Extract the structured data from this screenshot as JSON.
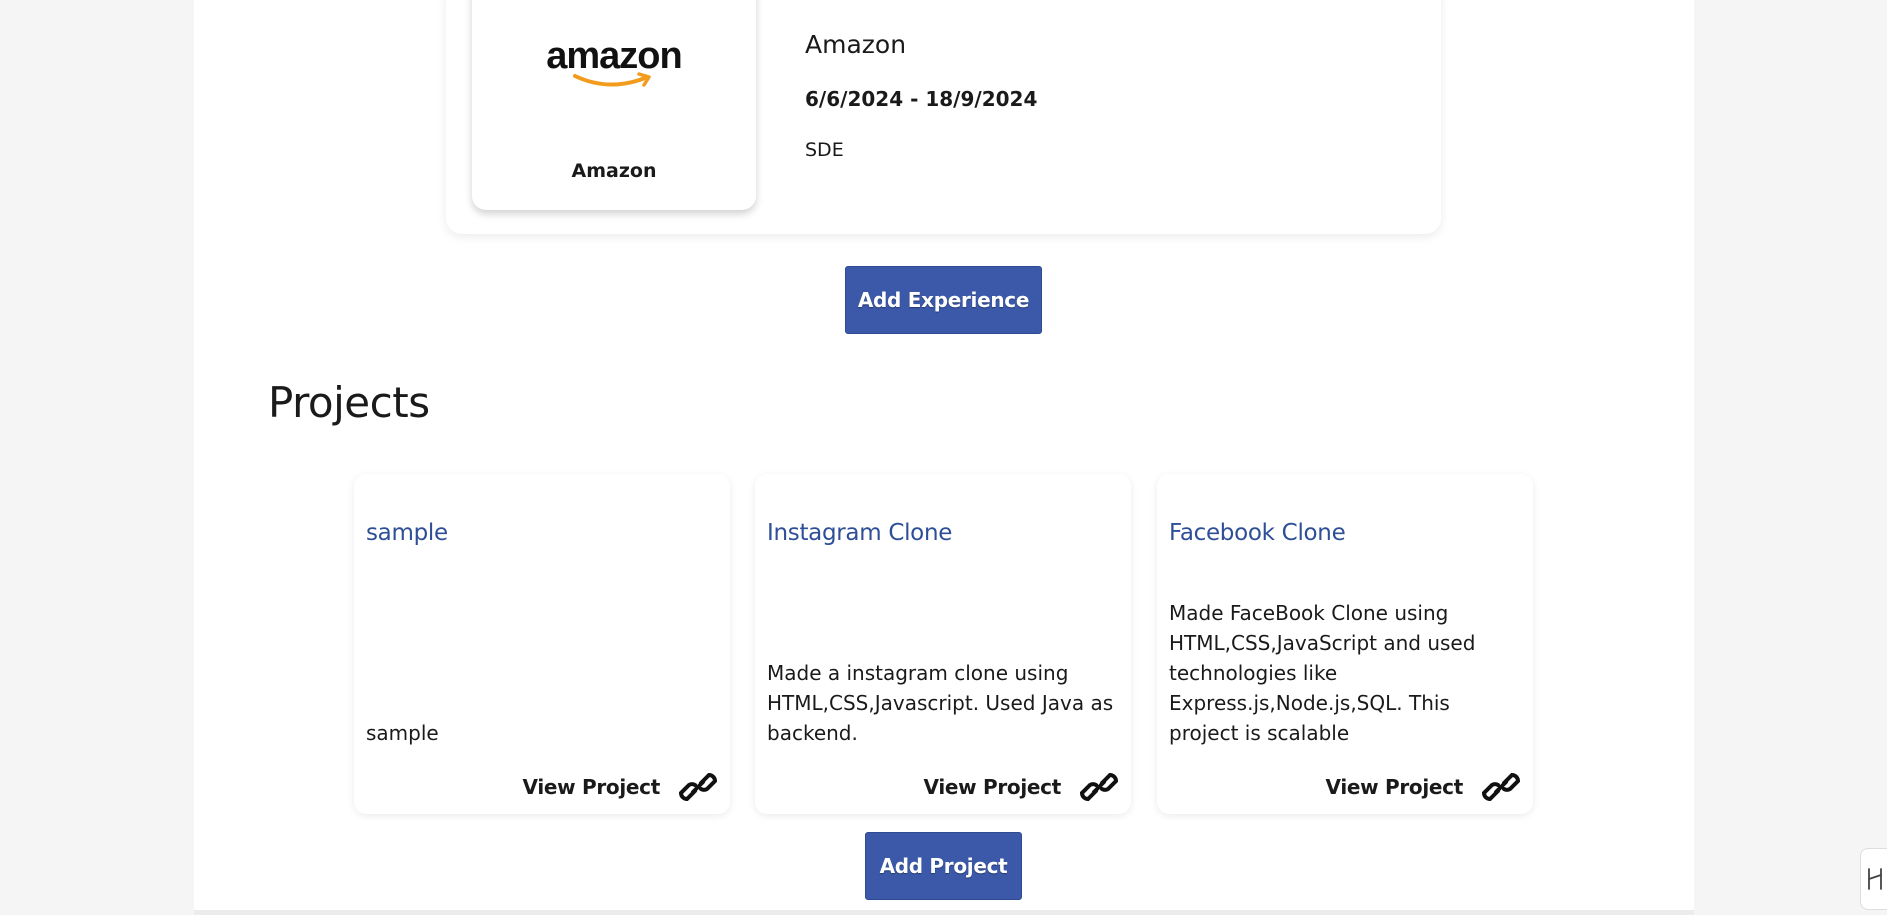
{
  "experience": {
    "logo_text": "amazon",
    "logo_caption": "Amazon",
    "company": "Amazon",
    "dates": "6/6/2024 - 18/9/2024",
    "role": "SDE",
    "add_button_label": "Add Experience"
  },
  "projects": {
    "section_title": "Projects",
    "items": [
      {
        "title": "sample",
        "description": "sample",
        "link_label": "View Project",
        "link_icon": "link-icon"
      },
      {
        "title": "Instagram Clone",
        "description": "Made a instagram clone using HTML,CSS,Javascript. Used Java as backend.",
        "link_label": "View Project",
        "link_icon": "link-icon"
      },
      {
        "title": "Facebook Clone",
        "description": "Made FaceBook Clone using HTML,CSS,JavaScript and used technologies like Express.js,Node.js,SQL. This project is scalable",
        "link_label": "View Project",
        "link_icon": "link-icon"
      }
    ],
    "add_button_label": "Add Project"
  },
  "colors": {
    "accent": "#3b59a8",
    "project_title": "#2e4f97",
    "amazon_smile": "#f39b1c"
  }
}
